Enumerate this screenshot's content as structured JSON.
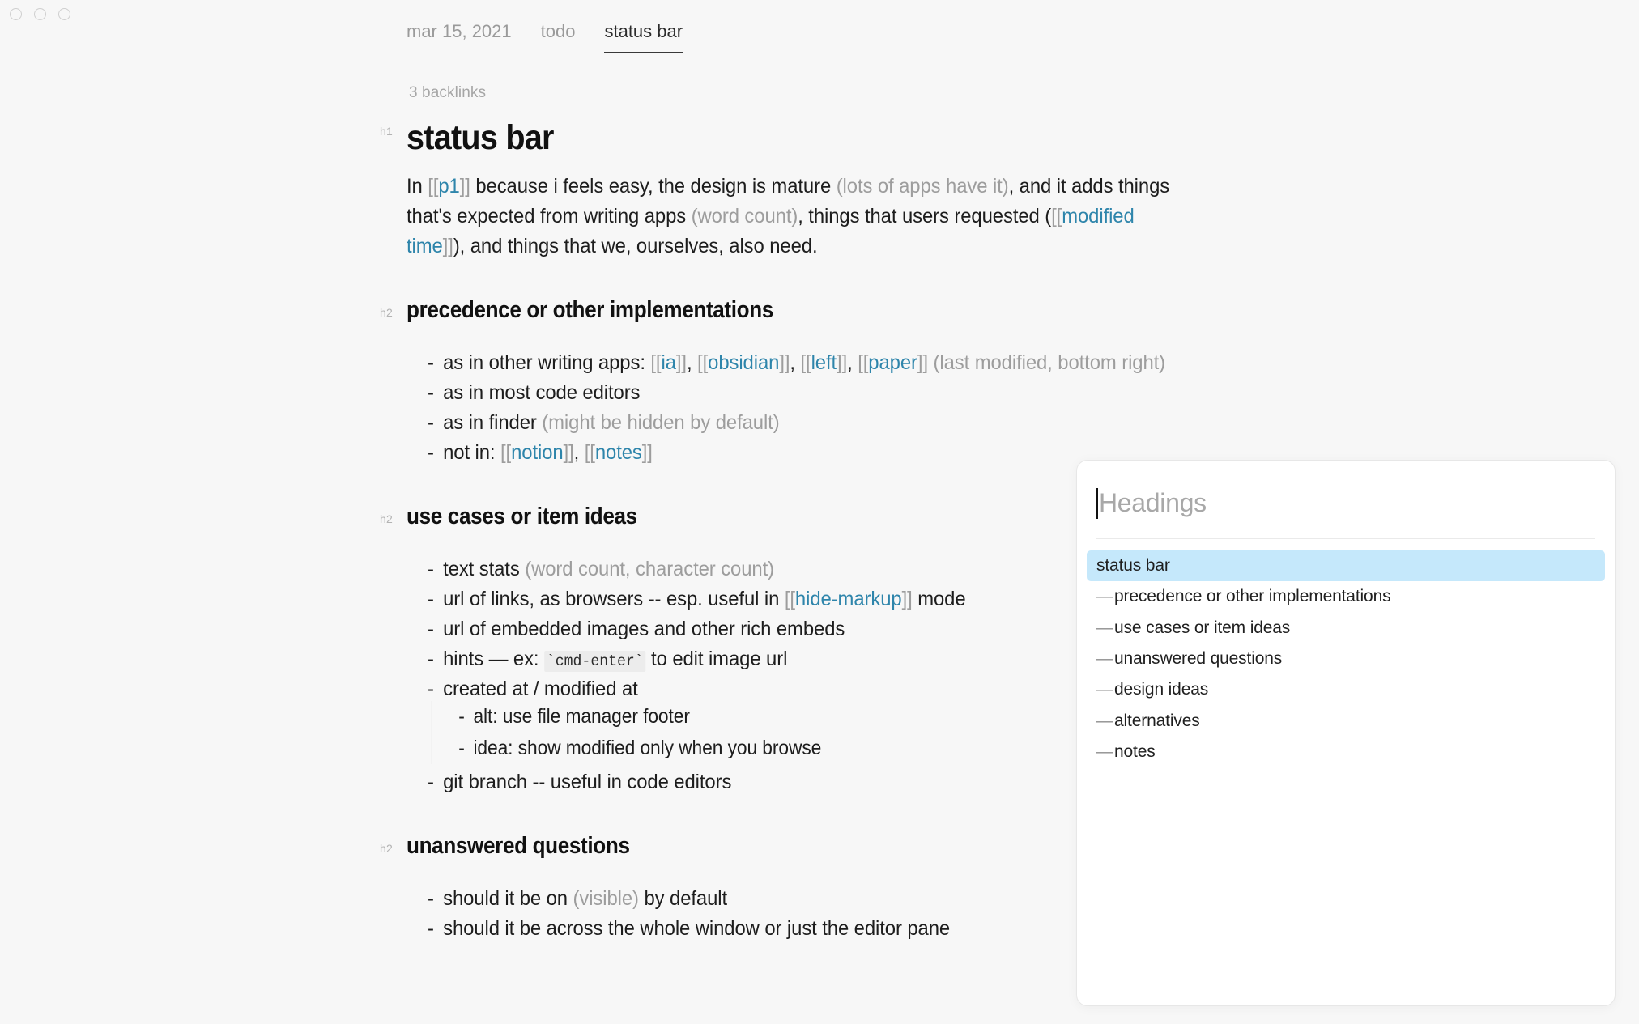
{
  "window": {
    "traffic_lights": [
      "close",
      "minimize",
      "zoom"
    ]
  },
  "tabbar": {
    "tabs": [
      {
        "label": "mar 15, 2021",
        "active": false
      },
      {
        "label": "todo",
        "active": false
      },
      {
        "label": "status bar",
        "active": true
      }
    ]
  },
  "document": {
    "backlinks": "3 backlinks",
    "h1_tag": "h1",
    "h2_tag": "h2",
    "title": "status bar",
    "intro": {
      "t1": "In ",
      "b1": "[[",
      "l1": "p1",
      "b2": "]]",
      "t2": " because i feels easy, the design is mature ",
      "m1": "(lots of apps have it)",
      "t3": ", and it adds things that's expected from writing apps ",
      "m2": "(word count)",
      "t4": ", things that users requested (",
      "b3": "[[",
      "l2": "modified time",
      "b4": "]]",
      "t5": "), and things that we, ourselves, also need."
    },
    "sections": [
      {
        "heading": "precedence or other implementations",
        "items": [
          {
            "t1": "as in other writing apps: ",
            "b1": "[[",
            "l1": "ia",
            "b2": "]]",
            "t2": ", ",
            "b3": "[[",
            "l2": "obsidian",
            "b4": "]]",
            "t3": ", ",
            "b5": "[[",
            "l3": "left",
            "b6": "]]",
            "t4": ", ",
            "b7": "[[",
            "l4": "paper",
            "b8": "]]",
            "t5": " ",
            "m1": "(last modified, bottom right)"
          },
          {
            "t1": "as in most code editors"
          },
          {
            "t1": "as in finder ",
            "m1": "(might be hidden by default)"
          },
          {
            "t1": "not in: ",
            "b1": "[[",
            "l1": "notion",
            "b2": "]]",
            "t2": ", ",
            "b3": "[[",
            "l2": "notes",
            "b4": "]]"
          }
        ]
      },
      {
        "heading": "use cases or item ideas",
        "items": [
          {
            "t1": "text stats ",
            "m1": "(word count, character count)"
          },
          {
            "t1": "url of links, as browsers -- esp. useful in ",
            "b1": "[[",
            "l1": "hide-markup",
            "b2": "]]",
            "t2": " mode"
          },
          {
            "t1": "url of embedded images and other rich embeds"
          },
          {
            "t1": "hints — ex: ",
            "code": "`cmd-enter`",
            "t2": " to edit image url"
          },
          {
            "t1": "created at / modified at",
            "sub": [
              {
                "t1": "alt: use file manager footer"
              },
              {
                "t1": "idea: show modified only when you browse"
              }
            ]
          },
          {
            "t1": "git branch -- useful in code editors"
          }
        ]
      },
      {
        "heading": "unanswered questions",
        "items": [
          {
            "t1": "should it be on ",
            "m1": "(visible)",
            "t2": " by default"
          },
          {
            "t1": "should it be across the whole window or just the editor pane"
          }
        ]
      }
    ]
  },
  "palette": {
    "placeholder": "Headings",
    "value": "",
    "items": [
      {
        "label": "status bar",
        "level": 1,
        "selected": true
      },
      {
        "label": "precedence or other implementations",
        "level": 2,
        "selected": false
      },
      {
        "label": "use cases or item ideas",
        "level": 2,
        "selected": false
      },
      {
        "label": "unanswered questions",
        "level": 2,
        "selected": false
      },
      {
        "label": "design ideas",
        "level": 2,
        "selected": false
      },
      {
        "label": "alternatives",
        "level": 2,
        "selected": false
      },
      {
        "label": "notes",
        "level": 2,
        "selected": false
      }
    ],
    "level_dash": "—",
    "selected_color": "#c5e8fb"
  },
  "colors": {
    "background": "#f7f7f7",
    "link": "#2e85ab",
    "muted": "#9d9d9d",
    "text": "#1d1d1d"
  },
  "list_bullet": "-"
}
